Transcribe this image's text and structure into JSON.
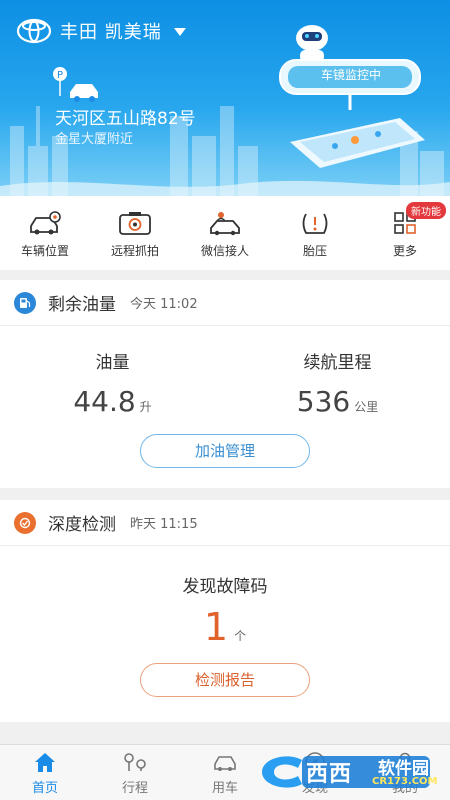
{
  "header": {
    "brand": "丰田 凯美瑞",
    "address": "天河区五山路82号",
    "landmark": "金星大厦附近",
    "monitor_label": "车镜监控中"
  },
  "actions": [
    {
      "label": "车辆位置",
      "icon": "car-location-icon"
    },
    {
      "label": "远程抓拍",
      "icon": "camera-icon"
    },
    {
      "label": "微信接人",
      "icon": "wechat-pickup-icon"
    },
    {
      "label": "胎压",
      "icon": "tire-pressure-icon"
    },
    {
      "label": "更多",
      "icon": "grid-more-icon",
      "badge": "新功能"
    }
  ],
  "fuel_card": {
    "title": "剩余油量",
    "time": "今天 11:02",
    "fuel_label": "油量",
    "fuel_value": "44.8",
    "fuel_unit": "升",
    "range_label": "续航里程",
    "range_value": "536",
    "range_unit": "公里",
    "button": "加油管理"
  },
  "diag_card": {
    "title": "深度检测",
    "time": "昨天 11:15",
    "fault_label": "发现故障码",
    "fault_count": "1",
    "fault_unit": "个",
    "button": "检测报告"
  },
  "nav": [
    {
      "label": "首页",
      "icon": "home-icon",
      "active": true
    },
    {
      "label": "行程",
      "icon": "route-icon"
    },
    {
      "label": "用车",
      "icon": "car-icon"
    },
    {
      "label": "发现",
      "icon": "discover-icon"
    },
    {
      "label": "我的",
      "icon": "profile-icon"
    }
  ],
  "watermark": {
    "text": "西西",
    "brand": "软件园",
    "site": "CR173.COM"
  },
  "colors": {
    "header_blue": "#0d8fe3",
    "accent_blue": "#1a8be6",
    "accent_orange": "#e0632b",
    "badge_red": "#e4393c"
  }
}
